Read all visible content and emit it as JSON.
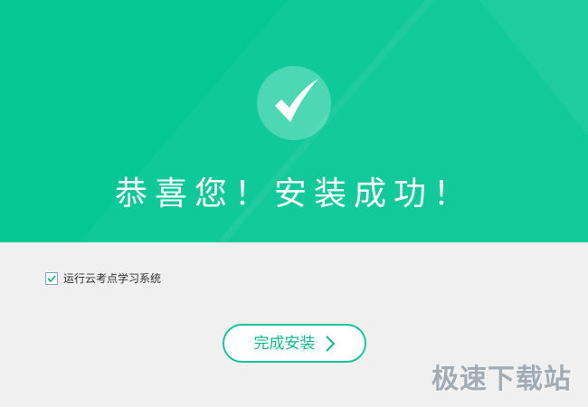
{
  "hero": {
    "title": "恭喜您！安装成功！",
    "background_color": "#04c793",
    "icon": "checkmark-icon"
  },
  "options": {
    "run_after_install": {
      "label": "运行云考点学习系统",
      "checked": true,
      "icon": "checkmark-icon"
    }
  },
  "actions": {
    "finish_label": "完成安装",
    "finish_icon": "chevron-right-icon",
    "accent_color": "#16c69a"
  },
  "watermark": {
    "text": "极速下载站"
  }
}
